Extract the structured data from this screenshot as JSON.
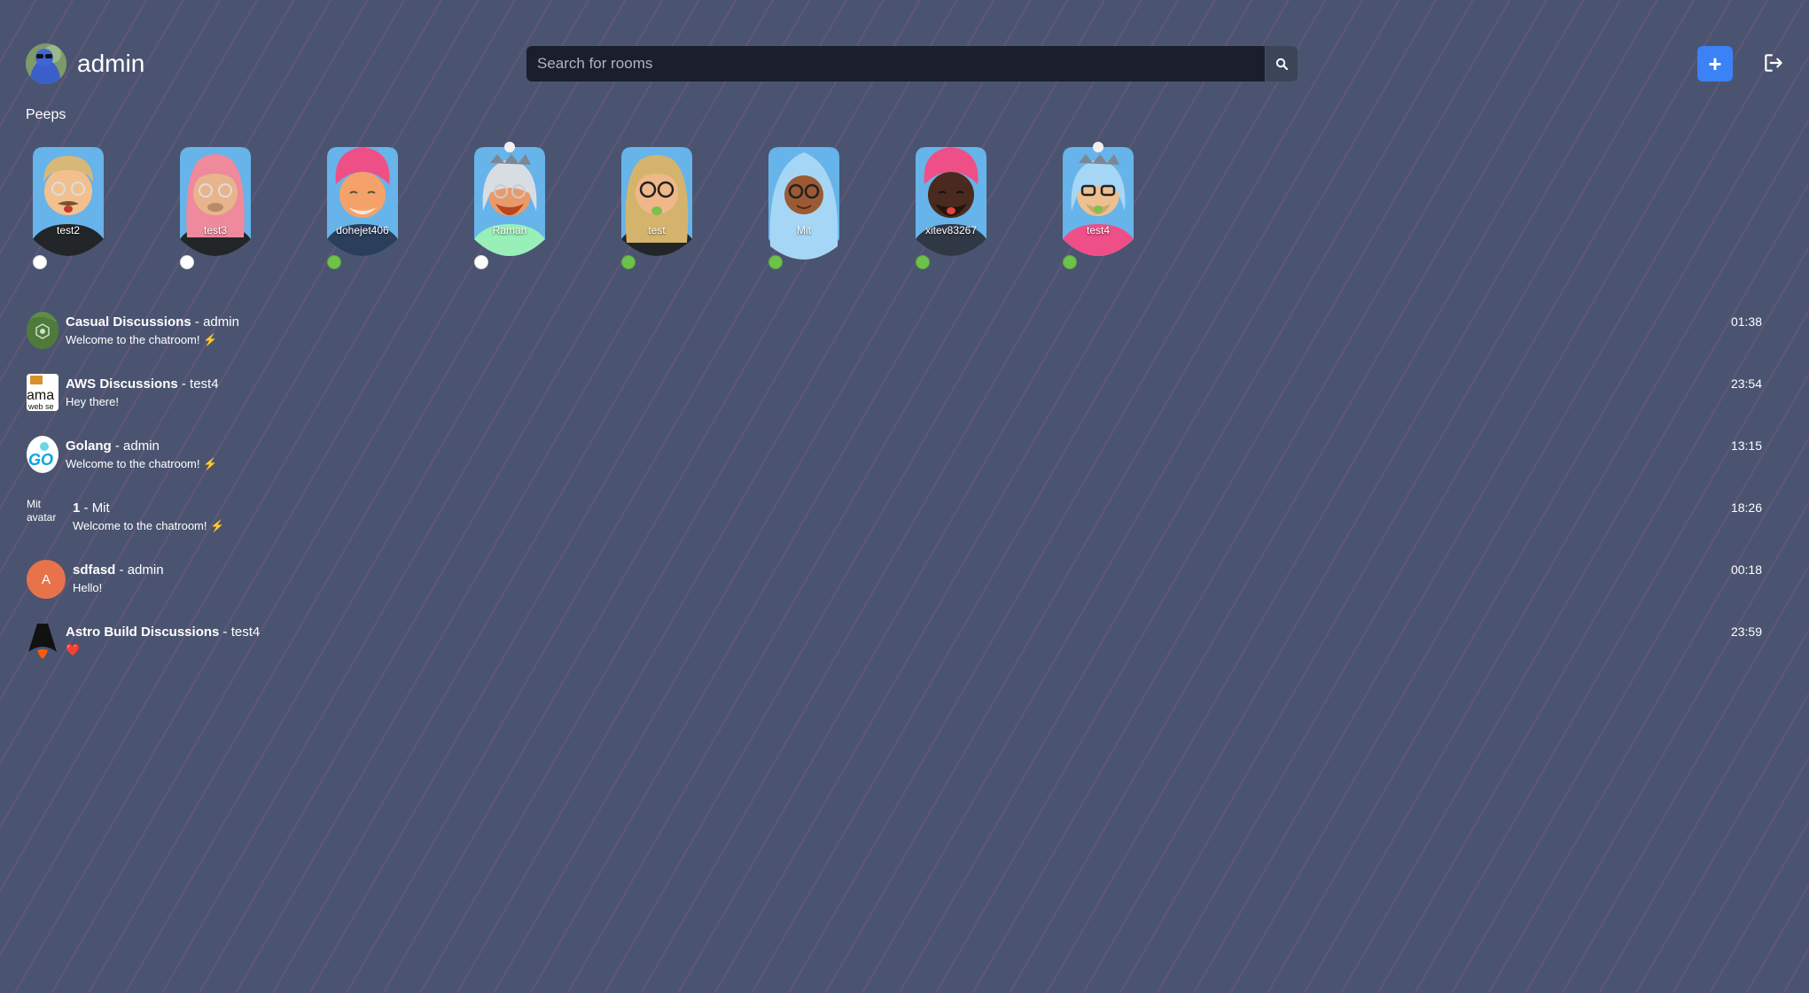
{
  "user": {
    "name": "admin"
  },
  "search": {
    "placeholder": "Search for rooms"
  },
  "peeps": {
    "title": "Peeps",
    "people": [
      {
        "name": "test2",
        "status": "offline",
        "status_color": "#ffffff"
      },
      {
        "name": "test3",
        "status": "offline",
        "status_color": "#ffffff"
      },
      {
        "name": "dohejet406",
        "status": "online",
        "status_color": "#6cc24a"
      },
      {
        "name": "Raman",
        "status": "offline",
        "status_color": "#ffffff"
      },
      {
        "name": "test",
        "status": "online",
        "status_color": "#6cc24a"
      },
      {
        "name": "Mit",
        "status": "online",
        "status_color": "#6cc24a"
      },
      {
        "name": "xitev83267",
        "status": "online",
        "status_color": "#6cc24a"
      },
      {
        "name": "test4",
        "status": "online",
        "status_color": "#6cc24a"
      }
    ]
  },
  "rooms": [
    {
      "name": "Casual Discussions",
      "owner": "admin",
      "message": "Welcome to the chatroom! ⚡",
      "time": "01:38",
      "icon": "casual-room-icon"
    },
    {
      "name": "AWS Discussions",
      "owner": "test4",
      "message": "Hey there!",
      "time": "23:54",
      "icon": "aws-room-icon",
      "icon_text": "ama"
    },
    {
      "name": "Golang",
      "owner": "admin",
      "message": "Welcome to the chatroom! ⚡",
      "time": "13:15",
      "icon": "golang-room-icon",
      "icon_text": "GO"
    },
    {
      "name": "1",
      "owner": "Mit",
      "message": "Welcome to the chatroom! ⚡",
      "time": "18:26",
      "icon": "broken-image-icon",
      "icon_text": "Mit avatar"
    },
    {
      "name": "sdfasd",
      "owner": "admin",
      "message": "Hello!",
      "time": "00:18",
      "icon": "letter-avatar-icon",
      "icon_text": "A"
    },
    {
      "name": "Astro Build Discussions",
      "owner": "test4",
      "message": "❤️",
      "time": "23:59",
      "icon": "astro-room-icon"
    }
  ],
  "colors": {
    "accent": "#3b82f6",
    "online": "#6cc24a",
    "offline": "#ffffff"
  }
}
